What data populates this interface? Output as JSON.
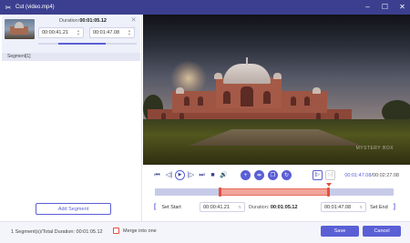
{
  "window": {
    "title": "Cut (video.mp4)",
    "minimize_icon": "minimize-icon",
    "maximize_icon": "maximize-icon",
    "close_icon": "close-icon"
  },
  "segment": {
    "duration_label": "Duration:",
    "duration_value": "00:01:05.12",
    "start": "00:00:41.21",
    "end": "00:01:47.08",
    "list_label": "Segment[1]",
    "range_fraction": [
      0.383,
      0.995
    ]
  },
  "left_panel": {
    "add_segment": "Add Segment"
  },
  "video": {
    "watermark": "MYSTERY BOX"
  },
  "player": {
    "current_time": "00:01:47.08",
    "total_time": "/00:02:27.08",
    "icons": [
      "skip-start-icon",
      "prev-frame-icon",
      "play-icon",
      "next-frame-icon",
      "skip-end-icon",
      "stop-icon",
      "volume-icon",
      "add-icon",
      "split-icon",
      "copy-icon",
      "rotate-icon",
      "jump-start-icon",
      "jump-end-icon"
    ]
  },
  "trim": {
    "set_start": "Set Start",
    "start_value": "00:00:41.21",
    "duration_label": "Duration:",
    "duration_value": "00:01:05.12",
    "end_value": "00:01:47.08",
    "set_end": "Set End",
    "selection_fraction": [
      0.28,
      0.728
    ]
  },
  "footer": {
    "summary": "1 Segment(s)/Total Duration: 00:01:05.12",
    "merge_label": "Merge into one",
    "save": "Save",
    "cancel": "Cancel"
  },
  "colors": {
    "accent": "#5a5fd6",
    "titlebar": "#3c3f8f",
    "selection": "#e4503f"
  }
}
